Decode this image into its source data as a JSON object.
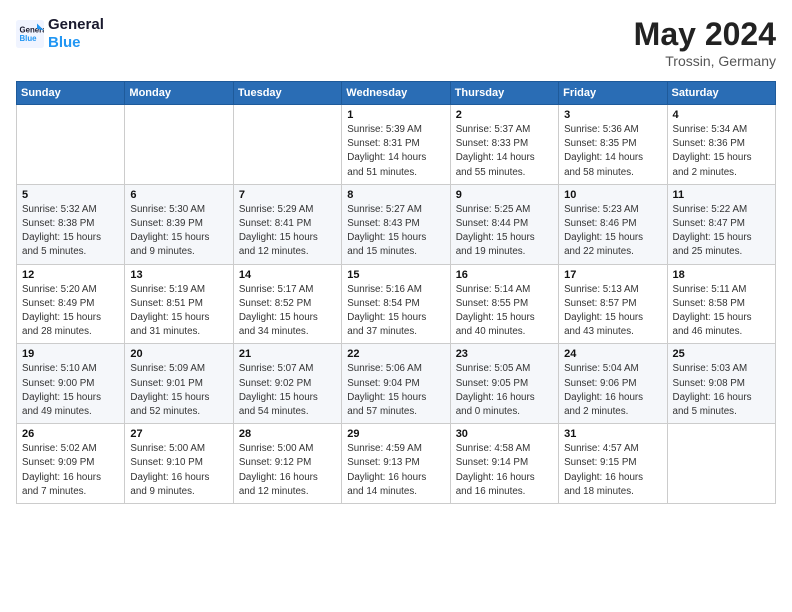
{
  "header": {
    "logo_line1": "General",
    "logo_line2": "Blue",
    "month": "May 2024",
    "location": "Trossin, Germany"
  },
  "weekdays": [
    "Sunday",
    "Monday",
    "Tuesday",
    "Wednesday",
    "Thursday",
    "Friday",
    "Saturday"
  ],
  "weeks": [
    [
      {
        "day": "",
        "info": ""
      },
      {
        "day": "",
        "info": ""
      },
      {
        "day": "",
        "info": ""
      },
      {
        "day": "1",
        "info": "Sunrise: 5:39 AM\nSunset: 8:31 PM\nDaylight: 14 hours\nand 51 minutes."
      },
      {
        "day": "2",
        "info": "Sunrise: 5:37 AM\nSunset: 8:33 PM\nDaylight: 14 hours\nand 55 minutes."
      },
      {
        "day": "3",
        "info": "Sunrise: 5:36 AM\nSunset: 8:35 PM\nDaylight: 14 hours\nand 58 minutes."
      },
      {
        "day": "4",
        "info": "Sunrise: 5:34 AM\nSunset: 8:36 PM\nDaylight: 15 hours\nand 2 minutes."
      }
    ],
    [
      {
        "day": "5",
        "info": "Sunrise: 5:32 AM\nSunset: 8:38 PM\nDaylight: 15 hours\nand 5 minutes."
      },
      {
        "day": "6",
        "info": "Sunrise: 5:30 AM\nSunset: 8:39 PM\nDaylight: 15 hours\nand 9 minutes."
      },
      {
        "day": "7",
        "info": "Sunrise: 5:29 AM\nSunset: 8:41 PM\nDaylight: 15 hours\nand 12 minutes."
      },
      {
        "day": "8",
        "info": "Sunrise: 5:27 AM\nSunset: 8:43 PM\nDaylight: 15 hours\nand 15 minutes."
      },
      {
        "day": "9",
        "info": "Sunrise: 5:25 AM\nSunset: 8:44 PM\nDaylight: 15 hours\nand 19 minutes."
      },
      {
        "day": "10",
        "info": "Sunrise: 5:23 AM\nSunset: 8:46 PM\nDaylight: 15 hours\nand 22 minutes."
      },
      {
        "day": "11",
        "info": "Sunrise: 5:22 AM\nSunset: 8:47 PM\nDaylight: 15 hours\nand 25 minutes."
      }
    ],
    [
      {
        "day": "12",
        "info": "Sunrise: 5:20 AM\nSunset: 8:49 PM\nDaylight: 15 hours\nand 28 minutes."
      },
      {
        "day": "13",
        "info": "Sunrise: 5:19 AM\nSunset: 8:51 PM\nDaylight: 15 hours\nand 31 minutes."
      },
      {
        "day": "14",
        "info": "Sunrise: 5:17 AM\nSunset: 8:52 PM\nDaylight: 15 hours\nand 34 minutes."
      },
      {
        "day": "15",
        "info": "Sunrise: 5:16 AM\nSunset: 8:54 PM\nDaylight: 15 hours\nand 37 minutes."
      },
      {
        "day": "16",
        "info": "Sunrise: 5:14 AM\nSunset: 8:55 PM\nDaylight: 15 hours\nand 40 minutes."
      },
      {
        "day": "17",
        "info": "Sunrise: 5:13 AM\nSunset: 8:57 PM\nDaylight: 15 hours\nand 43 minutes."
      },
      {
        "day": "18",
        "info": "Sunrise: 5:11 AM\nSunset: 8:58 PM\nDaylight: 15 hours\nand 46 minutes."
      }
    ],
    [
      {
        "day": "19",
        "info": "Sunrise: 5:10 AM\nSunset: 9:00 PM\nDaylight: 15 hours\nand 49 minutes."
      },
      {
        "day": "20",
        "info": "Sunrise: 5:09 AM\nSunset: 9:01 PM\nDaylight: 15 hours\nand 52 minutes."
      },
      {
        "day": "21",
        "info": "Sunrise: 5:07 AM\nSunset: 9:02 PM\nDaylight: 15 hours\nand 54 minutes."
      },
      {
        "day": "22",
        "info": "Sunrise: 5:06 AM\nSunset: 9:04 PM\nDaylight: 15 hours\nand 57 minutes."
      },
      {
        "day": "23",
        "info": "Sunrise: 5:05 AM\nSunset: 9:05 PM\nDaylight: 16 hours\nand 0 minutes."
      },
      {
        "day": "24",
        "info": "Sunrise: 5:04 AM\nSunset: 9:06 PM\nDaylight: 16 hours\nand 2 minutes."
      },
      {
        "day": "25",
        "info": "Sunrise: 5:03 AM\nSunset: 9:08 PM\nDaylight: 16 hours\nand 5 minutes."
      }
    ],
    [
      {
        "day": "26",
        "info": "Sunrise: 5:02 AM\nSunset: 9:09 PM\nDaylight: 16 hours\nand 7 minutes."
      },
      {
        "day": "27",
        "info": "Sunrise: 5:00 AM\nSunset: 9:10 PM\nDaylight: 16 hours\nand 9 minutes."
      },
      {
        "day": "28",
        "info": "Sunrise: 5:00 AM\nSunset: 9:12 PM\nDaylight: 16 hours\nand 12 minutes."
      },
      {
        "day": "29",
        "info": "Sunrise: 4:59 AM\nSunset: 9:13 PM\nDaylight: 16 hours\nand 14 minutes."
      },
      {
        "day": "30",
        "info": "Sunrise: 4:58 AM\nSunset: 9:14 PM\nDaylight: 16 hours\nand 16 minutes."
      },
      {
        "day": "31",
        "info": "Sunrise: 4:57 AM\nSunset: 9:15 PM\nDaylight: 16 hours\nand 18 minutes."
      },
      {
        "day": "",
        "info": ""
      }
    ]
  ]
}
